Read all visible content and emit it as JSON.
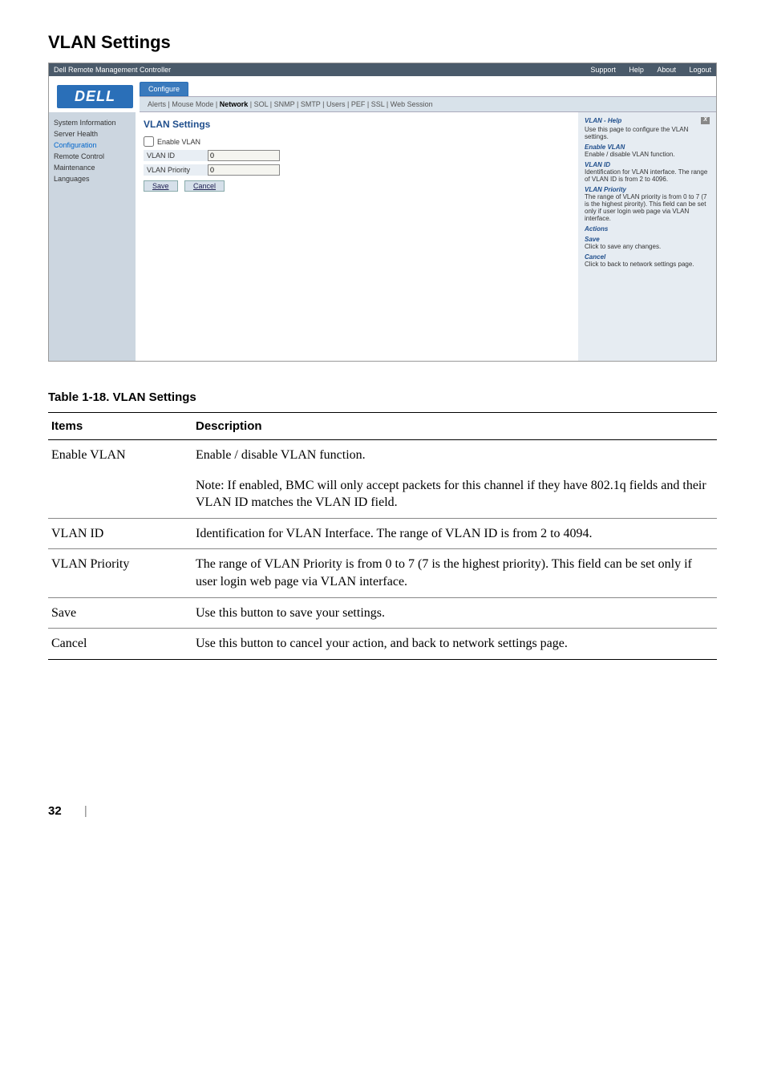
{
  "section_title": "VLAN Settings",
  "screenshot": {
    "titlebar_left": "Dell Remote Management Controller",
    "titlebar_right": [
      "Support",
      "Help",
      "About",
      "Logout"
    ],
    "dell_logo": "DELL",
    "active_tab": "Configure",
    "subtabs": [
      "Alerts",
      "Mouse Mode",
      "Network",
      "SOL",
      "SNMP",
      "SMTP",
      "Users",
      "PEF",
      "SSL",
      "Web Session"
    ],
    "sidebar": [
      {
        "label": "System Information",
        "sel": false
      },
      {
        "label": "Server Health",
        "sel": false
      },
      {
        "label": "Configuration",
        "sel": true
      },
      {
        "label": "Remote Control",
        "sel": false
      },
      {
        "label": "Maintenance",
        "sel": false
      },
      {
        "label": "Languages",
        "sel": false
      }
    ],
    "pane_title": "VLAN Settings",
    "enable_label": "Enable VLAN",
    "vlan_id_label": "VLAN ID",
    "vlan_id_value": "0",
    "vlan_priority_label": "VLAN Priority",
    "vlan_priority_value": "0",
    "save_btn": "Save",
    "cancel_btn": "Cancel",
    "help": {
      "title": "VLAN - Help",
      "intro": "Use this page to configure the VLAN settings.",
      "sections": [
        {
          "h": "Enable VLAN",
          "t": "Enable / disable VLAN function."
        },
        {
          "h": "VLAN ID",
          "t": "Identification for VLAN interface. The range of VLAN ID is from 2 to 4096."
        },
        {
          "h": "VLAN Priority",
          "t": "The range of VLAN priority is from 0 to 7 (7 is the highest pirority). This field can be set only if user login web page via VLAN interface."
        },
        {
          "h": "Actions",
          "t": ""
        },
        {
          "h": "Save",
          "t": "Click to save any changes."
        },
        {
          "h": "Cancel",
          "t": "Click to back to network settings page."
        }
      ]
    }
  },
  "table": {
    "caption": "Table 1-18.    VLAN Settings",
    "header_items": "Items",
    "header_desc": "Description",
    "rows": [
      {
        "item": "Enable VLAN",
        "desc": [
          "Enable / disable VLAN function.",
          "Note: If enabled, BMC will only accept packets for this channel if they have 802.1q fields and their VLAN ID matches the VLAN ID field."
        ]
      },
      {
        "item": "VLAN ID",
        "desc": [
          "Identification for VLAN Interface. The range of VLAN ID is from 2 to 4094."
        ]
      },
      {
        "item": "VLAN Priority",
        "desc": [
          "The range of VLAN Priority is from 0 to 7 (7 is the highest priority). This field can be set only if user login web page via VLAN interface."
        ]
      },
      {
        "item": "Save",
        "desc": [
          "Use this button to save your settings."
        ]
      },
      {
        "item": "Cancel",
        "desc": [
          "Use this button to cancel your action, and back to network settings page."
        ]
      }
    ]
  },
  "page_number": "32"
}
